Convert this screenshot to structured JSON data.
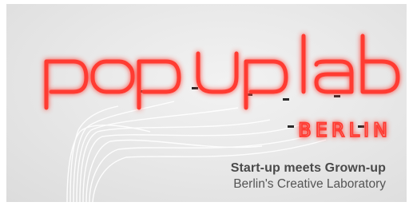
{
  "image": {
    "logo": {
      "wordmark": "pop up lab",
      "city": "BERLIN",
      "neon_color": "#ff3b30",
      "glow_color": "#ff6a5a"
    },
    "tagline": {
      "line1": "Start-up meets Grown-up",
      "line2": "Berlin's Creative Laboratory"
    },
    "wall_color": "#e9e9e9",
    "text_color": "#4a4a4a"
  }
}
